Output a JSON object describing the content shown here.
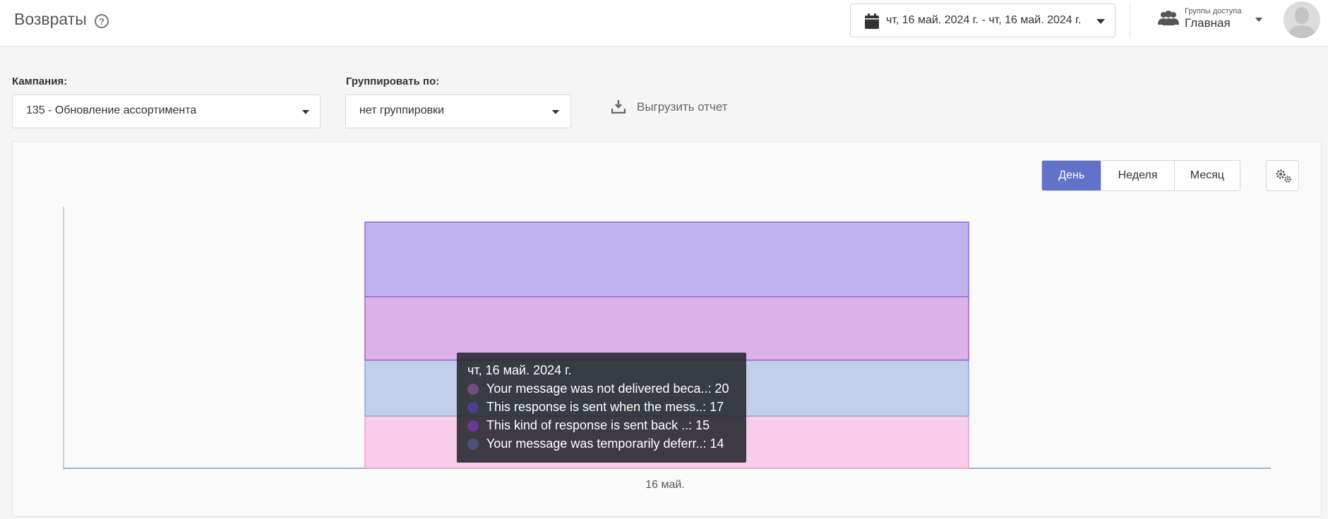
{
  "header": {
    "title": "Возвраты",
    "help_icon": "?",
    "date_range": "чт, 16 май. 2024 г. - чт, 16 май. 2024 г.",
    "access_groups_label": "Группы доступа",
    "access_groups_value": "Главная"
  },
  "filters": {
    "campaign_label": "Кампания:",
    "campaign_value": "135 - Обновление ассортимента",
    "group_by_label": "Группировать по:",
    "group_by_value": "нет группировки",
    "export_label": "Выгрузить отчет"
  },
  "period_tabs": [
    {
      "label": "День",
      "active": true
    },
    {
      "label": "Неделя",
      "active": false
    },
    {
      "label": "Месяц",
      "active": false
    }
  ],
  "icons": [
    "help-icon",
    "calendar-icon",
    "users-icon",
    "download-icon",
    "gears-icon",
    "avatar"
  ],
  "colors": {
    "accent": "#6173c9",
    "series": [
      "#f8cde9",
      "#c2cfea",
      "#dcb2e8",
      "#c0b2ec"
    ],
    "series_borders": [
      "#f29bd0",
      "#8ea6d8",
      "#a45ad2",
      "#8a68d9"
    ],
    "tooltip_dots": [
      "#6e4f7c",
      "#4d3f8a",
      "#6a3895",
      "#4c5178"
    ]
  },
  "chart_data": {
    "type": "bar",
    "stacked": true,
    "categories": [
      "16 май."
    ],
    "series": [
      {
        "name": "Your message was temporarily deferr..",
        "values": [
          14
        ]
      },
      {
        "name": "This kind of response is sent back ..",
        "values": [
          15
        ]
      },
      {
        "name": "This response is sent when the mess..",
        "values": [
          17
        ]
      },
      {
        "name": "Your message was not delivered beca..",
        "values": [
          20
        ]
      }
    ],
    "ylim": [
      0,
      70
    ],
    "grid": false,
    "legend": "none"
  },
  "tooltip": {
    "title": "чт, 16 май. 2024 г.",
    "rows": [
      {
        "label": "Your message was not delivered beca..: 20"
      },
      {
        "label": "This response is sent when the mess..: 17"
      },
      {
        "label": "This kind of response is sent back ..: 15"
      },
      {
        "label": "Your message was temporarily deferr..: 14"
      }
    ]
  }
}
